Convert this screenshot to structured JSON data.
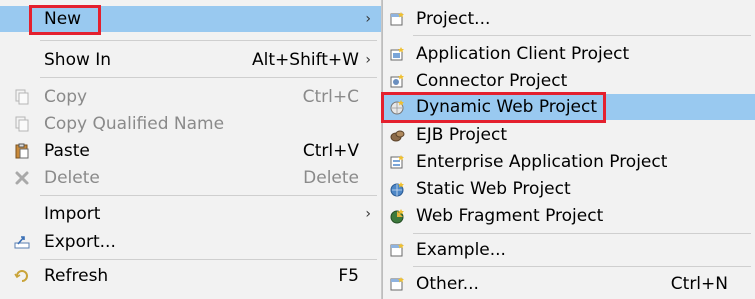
{
  "context_menu": {
    "items": [
      {
        "label": "New",
        "accel": "",
        "arrow": "›"
      },
      {
        "label": "Show In",
        "accel": "Alt+Shift+W",
        "arrow": "›"
      },
      {
        "label": "Copy",
        "accel": "Ctrl+C"
      },
      {
        "label": "Copy Qualified Name",
        "accel": ""
      },
      {
        "label": "Paste",
        "accel": "Ctrl+V"
      },
      {
        "label": "Delete",
        "accel": "Delete"
      },
      {
        "label": "Import",
        "accel": "",
        "arrow": "›"
      },
      {
        "label": "Export...",
        "accel": ""
      },
      {
        "label": "Refresh",
        "accel": "F5"
      }
    ]
  },
  "submenu": {
    "items": [
      {
        "label": "Project..."
      },
      {
        "label": "Application Client Project"
      },
      {
        "label": "Connector Project"
      },
      {
        "label": "Dynamic Web Project"
      },
      {
        "label": "EJB Project"
      },
      {
        "label": "Enterprise Application Project"
      },
      {
        "label": "Static Web Project"
      },
      {
        "label": "Web Fragment Project"
      },
      {
        "label": "Example..."
      },
      {
        "label": "Other...",
        "accel": "Ctrl+N"
      }
    ]
  },
  "colors": {
    "highlight": "#99c9f0",
    "annotation_red": "#e4202e",
    "menu_bg": "#f2f2f2",
    "disabled_text": "#8a8a8a"
  }
}
